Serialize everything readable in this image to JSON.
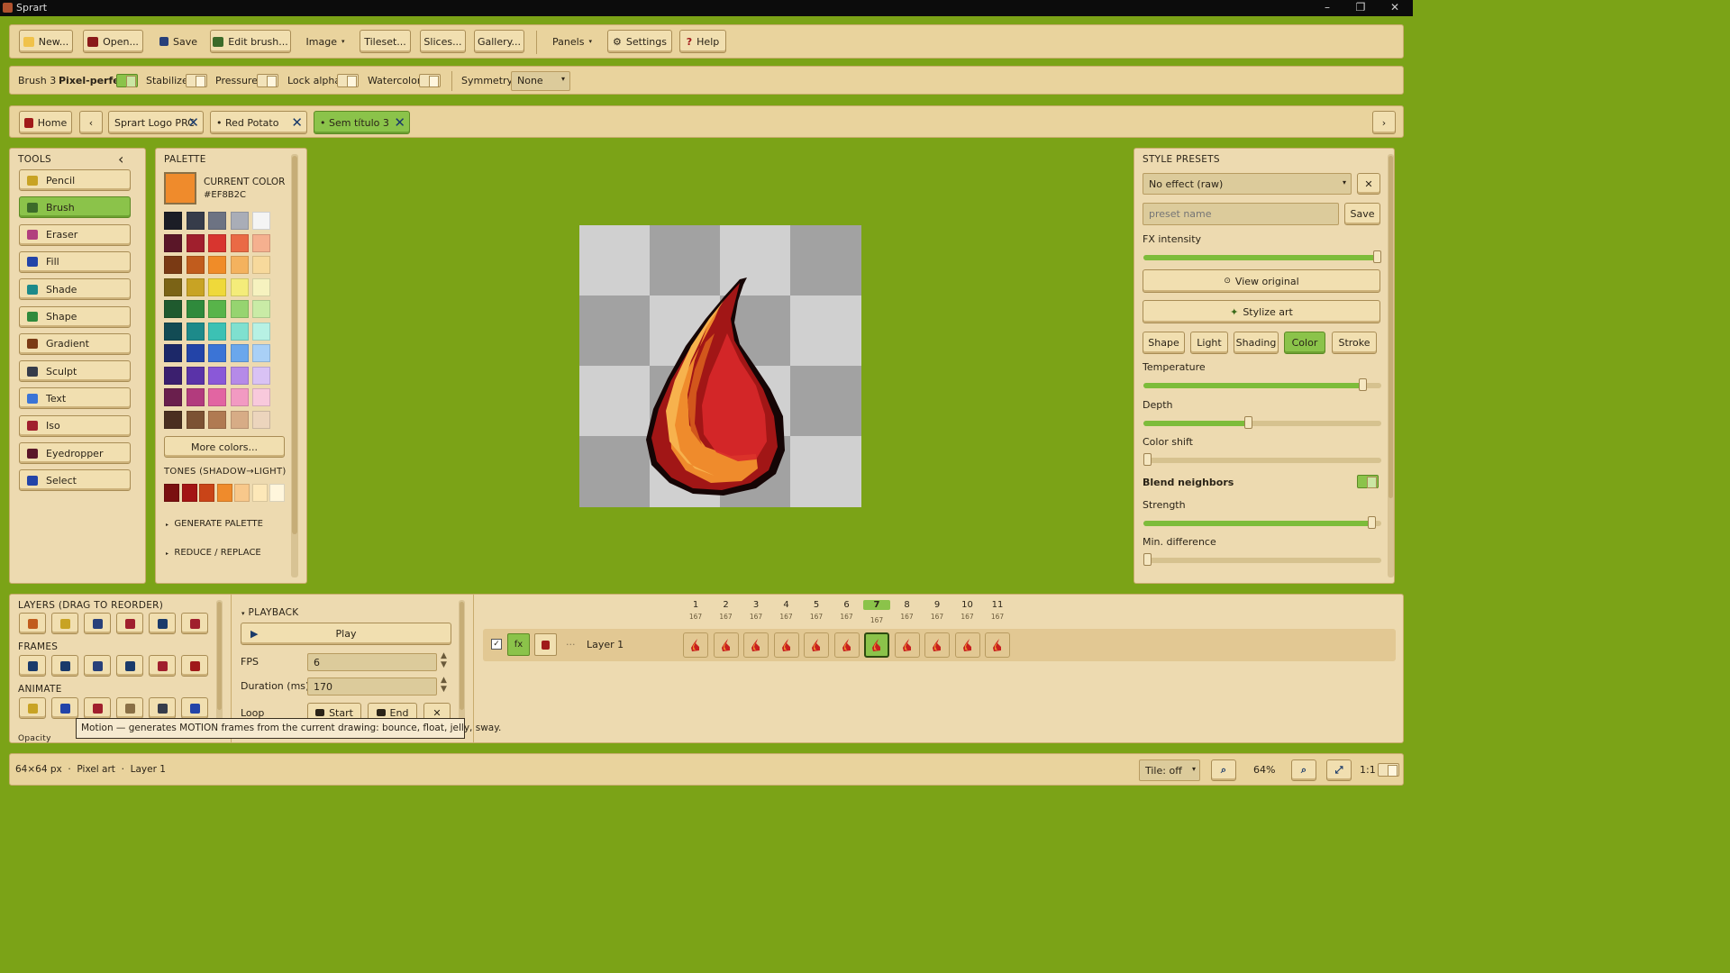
{
  "app": {
    "title": "Sprart"
  },
  "toolbar": {
    "new_label": "New...",
    "open_label": "Open...",
    "save_label": "Save",
    "edit_brush_label": "Edit brush...",
    "image_label": "Image",
    "tileset_label": "Tileset...",
    "slices_label": "Slices...",
    "gallery_label": "Gallery...",
    "panels_label": "Panels",
    "settings_label": "Settings",
    "help_label": "Help"
  },
  "brushbar": {
    "brush_name": "Brush 3",
    "pixel_perfect": {
      "label": "Pixel-perfect",
      "on": true
    },
    "stabilize": {
      "label": "Stabilize",
      "on": false
    },
    "pressure": {
      "label": "Pressure",
      "on": false
    },
    "lock_alpha": {
      "label": "Lock alpha",
      "on": false
    },
    "watercolor": {
      "label": "Watercolor",
      "on": false
    },
    "symmetry_label": "Symmetry",
    "symmetry_value": "None"
  },
  "tabs": {
    "home_label": "Home",
    "items": [
      {
        "label": "Sprart Logo PRC",
        "active": false
      },
      {
        "label": "• Red Potato",
        "active": false
      },
      {
        "label": "• Sem título 3",
        "active": true
      }
    ]
  },
  "tools": {
    "header": "TOOLS",
    "items": [
      {
        "label": "Pencil",
        "icon": "pencil-icon",
        "active": false
      },
      {
        "label": "Brush",
        "icon": "brush-icon",
        "active": true
      },
      {
        "label": "Eraser",
        "icon": "eraser-icon",
        "active": false
      },
      {
        "label": "Fill",
        "icon": "fill-bucket-icon",
        "active": false
      },
      {
        "label": "Shade",
        "icon": "shade-icon",
        "active": false
      },
      {
        "label": "Shape",
        "icon": "shape-icon",
        "active": false
      },
      {
        "label": "Gradient",
        "icon": "gradient-icon",
        "active": false
      },
      {
        "label": "Sculpt",
        "icon": "sculpt-icon",
        "active": false
      },
      {
        "label": "Text",
        "icon": "text-icon",
        "active": false
      },
      {
        "label": "Iso",
        "icon": "iso-icon",
        "active": false
      },
      {
        "label": "Eyedropper",
        "icon": "eyedropper-icon",
        "active": false
      },
      {
        "label": "Select",
        "icon": "select-icon",
        "active": false
      }
    ]
  },
  "palette": {
    "header": "PALETTE",
    "current_label": "CURRENT COLOR",
    "current_hex": "#EF8B2C",
    "swatches": [
      [
        "#1b1d26",
        "#363c4a",
        "#6d7383",
        "#a9adb7",
        "#f4f4f4"
      ],
      [
        "#5a1628",
        "#a01f2d",
        "#d8352f",
        "#ea6a45",
        "#f5b08f"
      ],
      [
        "#7a3a14",
        "#c15c1d",
        "#f08c28",
        "#f4b25e",
        "#f7d99c"
      ],
      [
        "#7b6316",
        "#c8a324",
        "#efd93a",
        "#f4ec7a",
        "#f6f2bf"
      ],
      [
        "#1f5a2e",
        "#2f8a3c",
        "#58b44a",
        "#96d470",
        "#c9eba6"
      ],
      [
        "#124b54",
        "#1d8a8a",
        "#3cc1b4",
        "#7fe0cf",
        "#b7f1e4"
      ],
      [
        "#1c2868",
        "#2344a8",
        "#3b74d6",
        "#6aa7ec",
        "#a9d0f6"
      ],
      [
        "#3b1f6e",
        "#5a33a8",
        "#8a58d8",
        "#b58ae8",
        "#d9c2f4"
      ],
      [
        "#6a1f4d",
        "#b23b7d",
        "#e265a2",
        "#f29ac2",
        "#f8c9dc"
      ],
      [
        "#4a2f20",
        "#7c5233",
        "#b07a52",
        "#d7ac86",
        "#ecd5bd"
      ]
    ],
    "more_colors_label": "More colors...",
    "tones_header": "TONES (SHADOW→LIGHT)",
    "tones": [
      "#7a1010",
      "#a31414",
      "#c94418",
      "#ef8b2c",
      "#f8c88b",
      "#fde8b8",
      "#fff6dc"
    ],
    "generate_label": "GENERATE PALETTE",
    "reduce_label": "REDUCE / REPLACE"
  },
  "style_presets": {
    "header": "STYLE PRESETS",
    "preset_value": "No effect (raw)",
    "preset_name_placeholder": "preset name",
    "save_label": "Save",
    "fx_intensity_label": "FX intensity",
    "fx_intensity": 1.0,
    "view_original_label": "View original",
    "stylize_label": "Stylize art",
    "tabs": [
      {
        "label": "Shape",
        "active": false
      },
      {
        "label": "Light",
        "active": false
      },
      {
        "label": "Shading",
        "active": false
      },
      {
        "label": "Color",
        "active": true
      },
      {
        "label": "Stroke",
        "active": false
      }
    ],
    "temperature_label": "Temperature",
    "temperature": 0.92,
    "depth_label": "Depth",
    "depth": 0.44,
    "color_shift_label": "Color shift",
    "color_shift": 0.0,
    "blend_neighbors_label": "Blend neighbors",
    "blend_neighbors": true,
    "strength_label": "Strength",
    "strength": 0.96,
    "min_difference_label": "Min. difference",
    "min_difference": 0.0
  },
  "layers": {
    "header": "LAYERS (DRAG TO REORDER)",
    "frames_header": "FRAMES",
    "animate_header": "ANIMATE",
    "opacity_label": "Opacity",
    "layer_name": "Layer 1",
    "fx_label": "fx",
    "dots": "···"
  },
  "playback": {
    "header": "PLAYBACK",
    "play_label": "Play",
    "fps_label": "FPS",
    "fps_value": "6",
    "duration_label": "Duration (ms)",
    "duration_value": "170",
    "loop_label": "Loop",
    "start_label": "Start",
    "end_label": "End"
  },
  "timeline": {
    "selected": 7,
    "frames": [
      {
        "n": "1",
        "d": "167"
      },
      {
        "n": "2",
        "d": "167"
      },
      {
        "n": "3",
        "d": "167"
      },
      {
        "n": "4",
        "d": "167"
      },
      {
        "n": "5",
        "d": "167"
      },
      {
        "n": "6",
        "d": "167"
      },
      {
        "n": "7",
        "d": "167"
      },
      {
        "n": "8",
        "d": "167"
      },
      {
        "n": "9",
        "d": "167"
      },
      {
        "n": "10",
        "d": "167"
      },
      {
        "n": "11",
        "d": "167"
      }
    ]
  },
  "tooltip": "Motion — generates MOTION frames from the current drawing: bounce, float, jelly, sway.",
  "status": {
    "info": "64×64 px  ·  Pixel art  ·  Layer 1",
    "tile_value": "Tile: off",
    "zoom": "64%",
    "ratio": "1:1"
  },
  "colors": {
    "accent": "#8bc34a",
    "canvas_bg": "#7ba317",
    "panel": "#eddab0"
  }
}
